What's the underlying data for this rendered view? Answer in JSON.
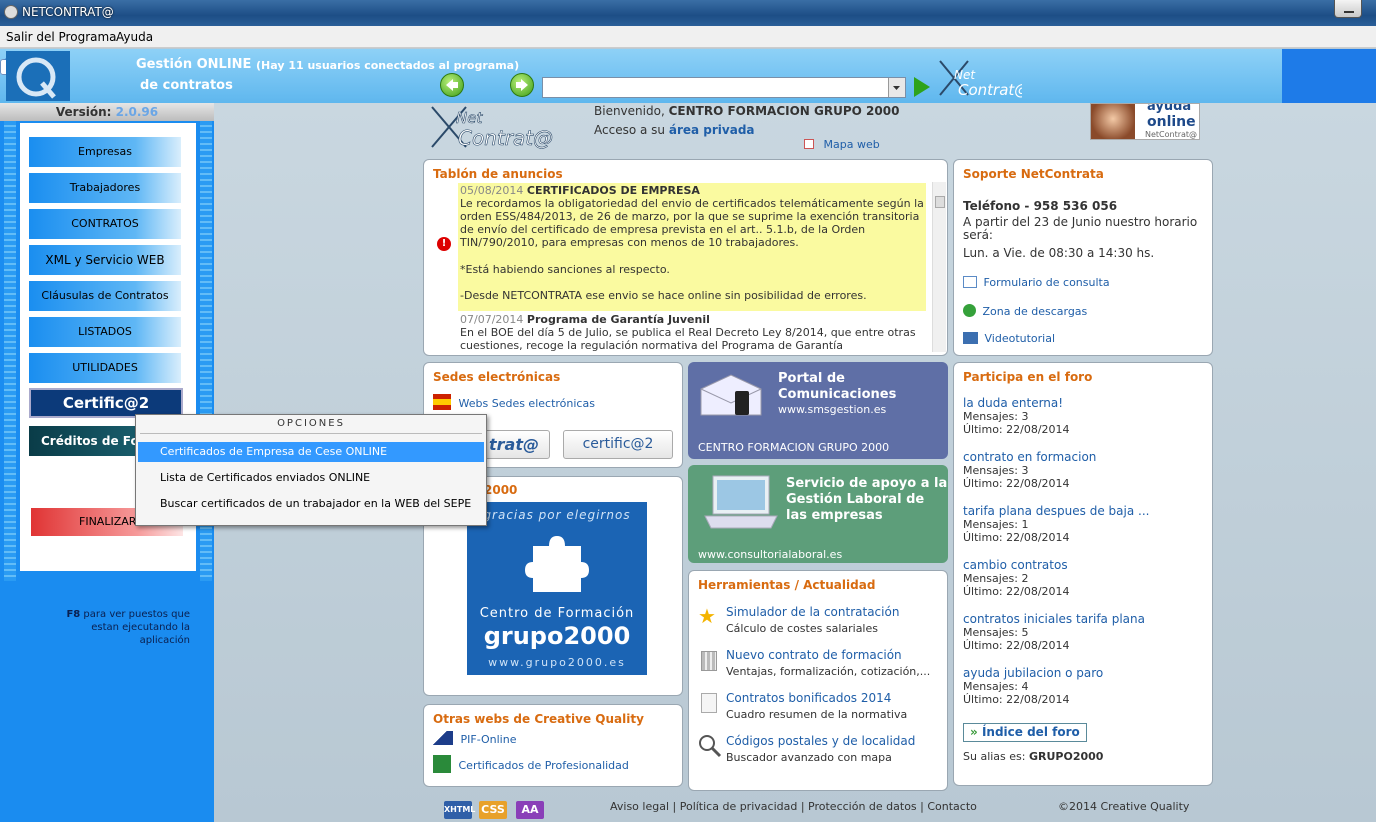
{
  "window": {
    "title": "NETCONTRAT@"
  },
  "menubar": {
    "items": [
      "Salir del Programa",
      "Ayuda"
    ]
  },
  "header": {
    "gestion_line1": "Gestión ONLINE",
    "gestion_line2": "de contratos",
    "users_notice": "(Hay 11 usuarios conectados al programa)",
    "address_value": ""
  },
  "sidebar": {
    "version_label": "Versión:",
    "version_value": "2.0.96",
    "buttons": [
      "Empresas",
      "Trabajadores",
      "CONTRATOS",
      "XML y Servicio WEB",
      "Cláusulas de Contratos",
      "LISTADOS",
      "UTILIDADES"
    ],
    "certif": "Certific@2",
    "creditos": "Créditos de Formación",
    "finalizar": "FINALIZAR",
    "f8_key": "F8",
    "f8_text": "para ver puestos que estan ejecutando la aplicación"
  },
  "context_menu": {
    "header": "OPCIONES",
    "items": [
      "Certificados de Empresa de Cese ONLINE",
      "Lista de Certificados enviados ONLINE",
      "Buscar certificados de un trabajador en la WEB del SEPE"
    ],
    "selected_index": 0
  },
  "welcome": {
    "text_prefix": "Bienvenido,",
    "company": "CENTRO FORMACION GRUPO 2000",
    "access_prefix": "Acceso a su",
    "access_link": "área privada",
    "sitemap": "Mapa web",
    "ad_line1": "ayuda",
    "ad_line2": "online",
    "ad_line3": "NetContrat@"
  },
  "anuncios": {
    "title": "Tablón de anuncios",
    "items": [
      {
        "date": "05/08/2014",
        "title": "CERTIFICADOS DE EMPRESA",
        "body": "Le recordamos la obligatoriedad del envio de certificados telemáticamente según la orden ESS/484/2013, de 26 de marzo, por la que se suprime la exención transitoria de envío del certificado de empresa prevista en el art.. 5.1.b, de la Orden TIN/790/2010, para empresas con menos de 10 trabajadores.",
        "note1": "*Está habiendo sanciones al respecto.",
        "note2": "-Desde NETCONTRATA ese envio se hace online sin posibilidad de errores."
      },
      {
        "date": "07/07/2014",
        "title": "Programa de Garantía Juvenil",
        "body": "En el BOE del día 5 de Julio, se publica el Real Decreto Ley 8/2014, que entre otras cuestiones, recoge la regulación normativa del Programa de Garantía"
      }
    ]
  },
  "soporte": {
    "title": "Soporte NetContrata",
    "phone": "Teléfono - 958 536 056",
    "schedule1": "A partir del 23 de Junio nuestro horario será:",
    "schedule2": "Lun. a Vie. de 08:30 a 14:30 hs.",
    "links": [
      "Formulario de consulta",
      "Zona de descargas",
      "Videotutorial"
    ]
  },
  "sedes": {
    "title": "Sedes electrónicas",
    "link": "Webs Sedes electrónicas",
    "btn1": "trat@",
    "btn2": "certific@2"
  },
  "portal": {
    "title1": "Portal de",
    "title2": "Comunicaciones",
    "url": "www.smsgestion.es",
    "footer": "CENTRO FORMACION GRUPO 2000"
  },
  "servicio": {
    "title": "Servicio de apoyo a la Gestión Laboral de las empresas",
    "url": "www.consultorialaboral.es"
  },
  "grupo": {
    "title": "2000",
    "gracias": "gracias por elegirnos",
    "centro": "Centro de Formación",
    "grupo": "grupo2000",
    "url": "www.grupo2000.es"
  },
  "herramientas": {
    "title": "Herramientas / Actualidad",
    "items": [
      {
        "title": "Simulador de la contratación",
        "sub": "Cálculo de costes salariales"
      },
      {
        "title": "Nuevo contrato de formación",
        "sub": "Ventajas, formalización, cotización,..."
      },
      {
        "title": "Contratos bonificados 2014",
        "sub": "Cuadro resumen de la normativa"
      },
      {
        "title": "Códigos postales y de localidad",
        "sub": "Buscador avanzado con mapa"
      }
    ]
  },
  "otras": {
    "title": "Otras webs de Creative Quality",
    "links": [
      "PIF-Online",
      "Certificados de Profesionalidad"
    ]
  },
  "foro": {
    "title": "Participa en el foro",
    "topics": [
      {
        "title": "la duda enterna!",
        "mensajes": "Mensajes: 3",
        "ultimo": "Último: 22/08/2014"
      },
      {
        "title": "contrato en formacion",
        "mensajes": "Mensajes: 3",
        "ultimo": "Último: 22/08/2014"
      },
      {
        "title": "tarifa plana despues de baja ...",
        "mensajes": "Mensajes: 1",
        "ultimo": "Último: 22/08/2014"
      },
      {
        "title": "cambio contratos",
        "mensajes": "Mensajes: 2",
        "ultimo": "Último: 22/08/2014"
      },
      {
        "title": "contratos iniciales tarifa plana",
        "mensajes": "Mensajes: 5",
        "ultimo": "Último: 22/08/2014"
      },
      {
        "title": "ayuda jubilacion o paro",
        "mensajes": "Mensajes: 4",
        "ultimo": "Último: 22/08/2014"
      }
    ],
    "index_btn": "Índice del foro",
    "alias_label": "Su alias es:",
    "alias": "GRUPO2000"
  },
  "footer": {
    "badges": [
      "XHTML",
      "CSS",
      "AA"
    ],
    "links": [
      "Aviso legal",
      "Política de privacidad",
      "Protección de datos",
      "Contacto"
    ],
    "copyright": "©2014 Creative Quality"
  }
}
